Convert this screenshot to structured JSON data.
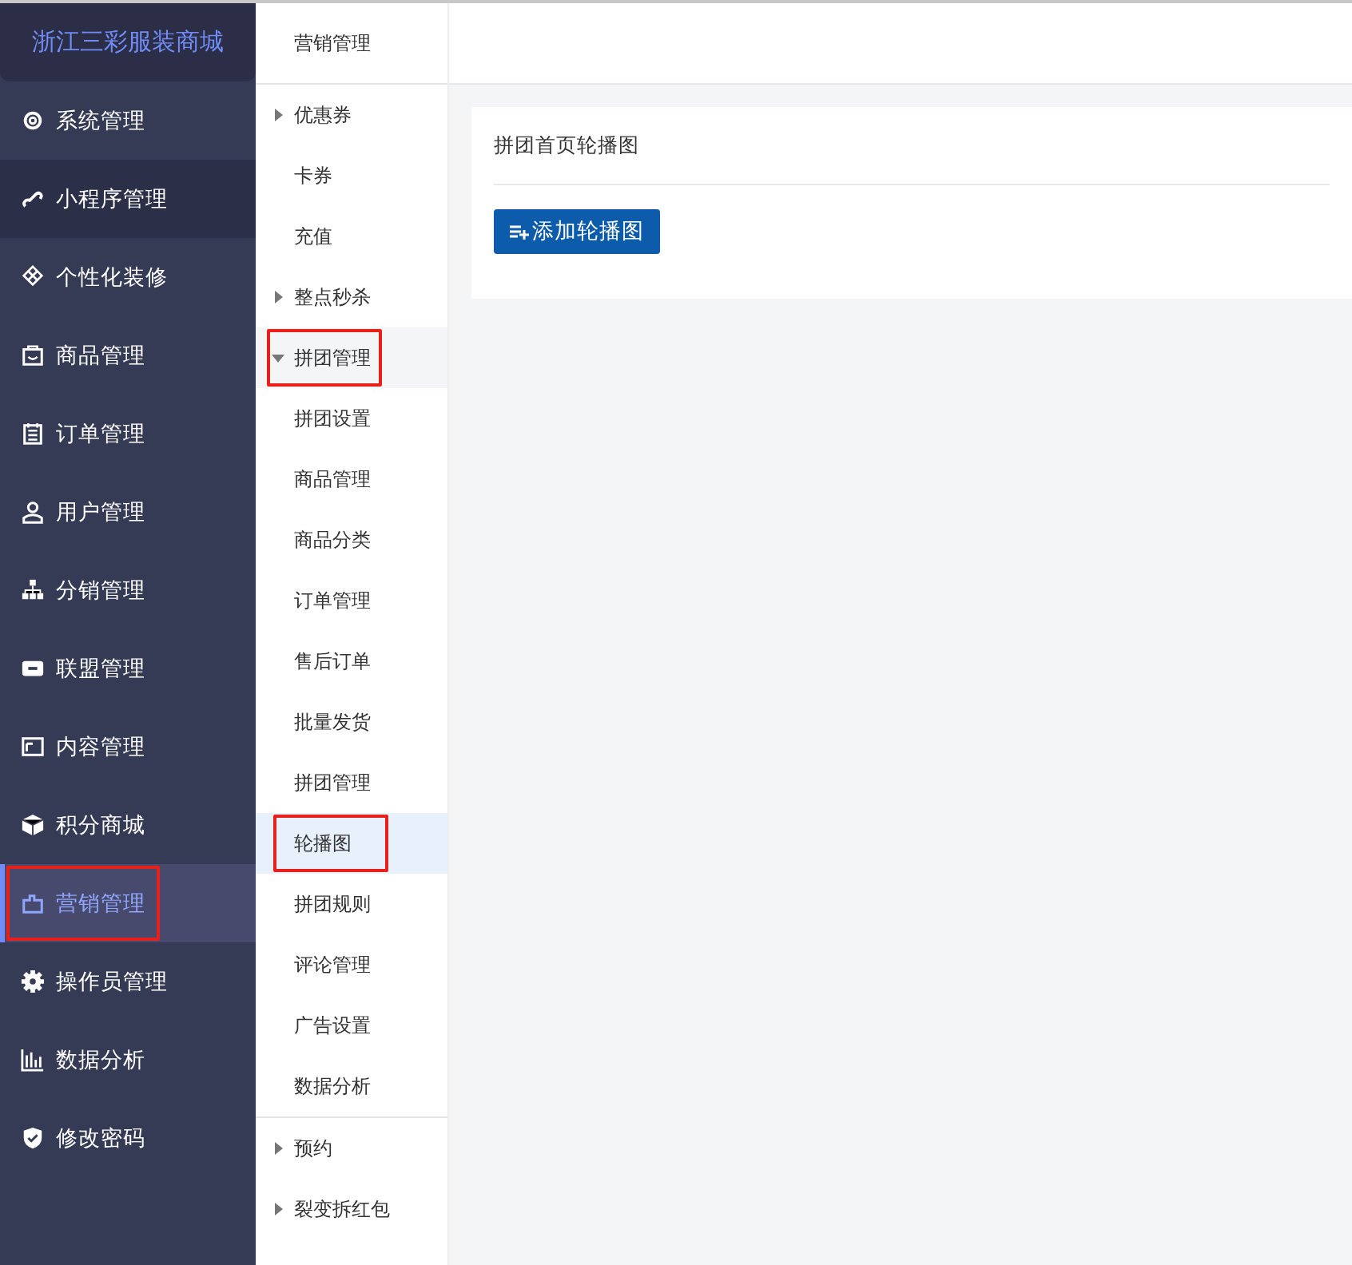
{
  "brand": "浙江三彩服装商城",
  "sidebar": {
    "items": [
      {
        "label": "系统管理",
        "selected": false,
        "hovered": false,
        "marked": false
      },
      {
        "label": "小程序管理",
        "selected": false,
        "hovered": true,
        "marked": false
      },
      {
        "label": "个性化装修",
        "selected": false,
        "hovered": false,
        "marked": false
      },
      {
        "label": "商品管理",
        "selected": false,
        "hovered": false,
        "marked": false
      },
      {
        "label": "订单管理",
        "selected": false,
        "hovered": false,
        "marked": false
      },
      {
        "label": "用户管理",
        "selected": false,
        "hovered": false,
        "marked": false
      },
      {
        "label": "分销管理",
        "selected": false,
        "hovered": false,
        "marked": false
      },
      {
        "label": "联盟管理",
        "selected": false,
        "hovered": false,
        "marked": false
      },
      {
        "label": "内容管理",
        "selected": false,
        "hovered": false,
        "marked": false
      },
      {
        "label": "积分商城",
        "selected": false,
        "hovered": false,
        "marked": false
      },
      {
        "label": "营销管理",
        "selected": true,
        "hovered": false,
        "marked": true
      },
      {
        "label": "操作员管理",
        "selected": false,
        "hovered": false,
        "marked": false
      },
      {
        "label": "数据分析",
        "selected": false,
        "hovered": false,
        "marked": false
      },
      {
        "label": "修改密码",
        "selected": false,
        "hovered": false,
        "marked": false
      }
    ]
  },
  "submenu": {
    "title": "营销管理",
    "items": [
      {
        "kind": "group",
        "label": "优惠券",
        "expanded": false,
        "marked": false
      },
      {
        "kind": "leaf",
        "label": "卡券",
        "selected": false,
        "marked": false
      },
      {
        "kind": "leaf",
        "label": "充值",
        "selected": false,
        "marked": false
      },
      {
        "kind": "group",
        "label": "整点秒杀",
        "expanded": false,
        "marked": false
      },
      {
        "kind": "group",
        "label": "拼团管理",
        "expanded": true,
        "marked": true,
        "children": [
          {
            "label": "拼团设置",
            "selected": false,
            "marked": false
          },
          {
            "label": "商品管理",
            "selected": false,
            "marked": false
          },
          {
            "label": "商品分类",
            "selected": false,
            "marked": false
          },
          {
            "label": "订单管理",
            "selected": false,
            "marked": false
          },
          {
            "label": "售后订单",
            "selected": false,
            "marked": false
          },
          {
            "label": "批量发货",
            "selected": false,
            "marked": false
          },
          {
            "label": "拼团管理",
            "selected": false,
            "marked": false
          },
          {
            "label": "轮播图",
            "selected": true,
            "marked": true
          },
          {
            "label": "拼团规则",
            "selected": false,
            "marked": false
          },
          {
            "label": "评论管理",
            "selected": false,
            "marked": false
          },
          {
            "label": "广告设置",
            "selected": false,
            "marked": false
          },
          {
            "label": "数据分析",
            "selected": false,
            "marked": false
          }
        ]
      },
      {
        "kind": "group",
        "label": "预约",
        "expanded": false,
        "marked": false
      },
      {
        "kind": "group",
        "label": "裂变拆红包",
        "expanded": false,
        "marked": false
      }
    ]
  },
  "panel": {
    "title": "拼团首页轮播图",
    "add_button": "添加轮播图"
  }
}
